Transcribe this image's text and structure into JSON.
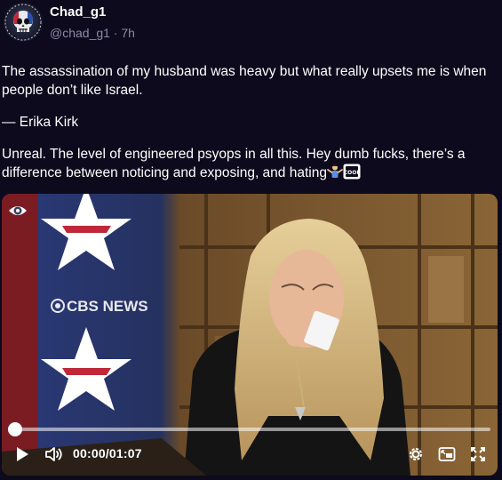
{
  "post": {
    "display_name": "Chad_g1",
    "handle": "@chad_g1",
    "separator": "·",
    "time_ago": "7h",
    "paragraphs": [
      "The assassination of my husband was heavy but what really upsets me is when people don’t like Israel.",
      "— Erika Kirk",
      "Unreal. The level of engineered psyops in all this.  Hey dumb fucks, there’s a difference between noticing and exposing, and hating"
    ],
    "emojis": [
      "person-shrugging-icon",
      "cool-button-icon"
    ]
  },
  "video": {
    "watermark_text": "CBS NEWS",
    "current_time": "00:00",
    "duration": "/01:07",
    "progress": 0.0
  },
  "colors": {
    "background": "#0c0a1c",
    "muted_text": "#8d8aa6"
  }
}
